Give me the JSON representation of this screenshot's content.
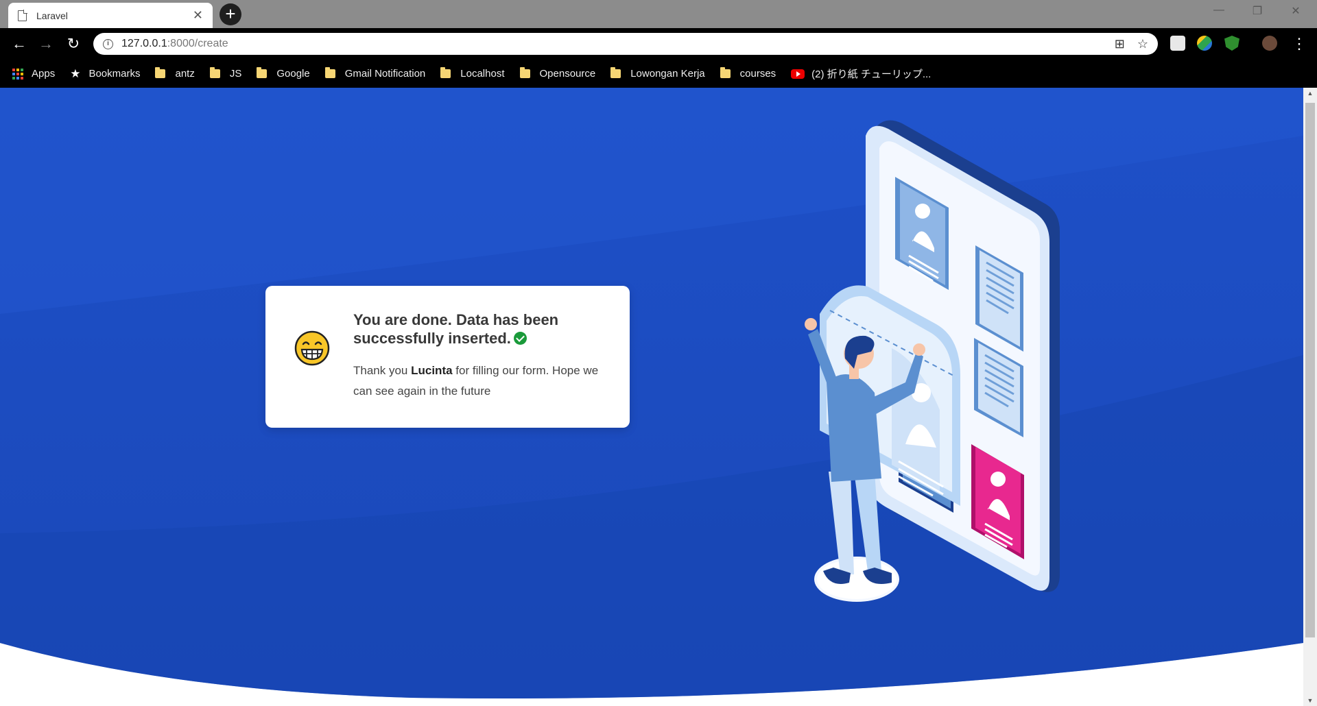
{
  "browser": {
    "tab_title": "Laravel",
    "url_host": "127.0.0.1",
    "url_path": ":8000/create"
  },
  "bookmarks": {
    "apps": "Apps",
    "bookmarks": "Bookmarks",
    "items": [
      "antz",
      "JS",
      "Google",
      "Gmail Notification",
      "Localhost",
      "Opensource",
      "Lowongan Kerja",
      "courses"
    ],
    "youtube": "(2) 折り紙 チューリップ..."
  },
  "card": {
    "heading": "You are done. Data has been successfully inserted.",
    "thanks_prefix": "Thank you ",
    "name": "Lucinta",
    "thanks_suffix": " for filling our form. Hope we can see again in the future"
  },
  "colors": {
    "background_blue": "#1d4fc4",
    "check_green": "#1a9a3a",
    "accent_pink": "#e8288f"
  }
}
